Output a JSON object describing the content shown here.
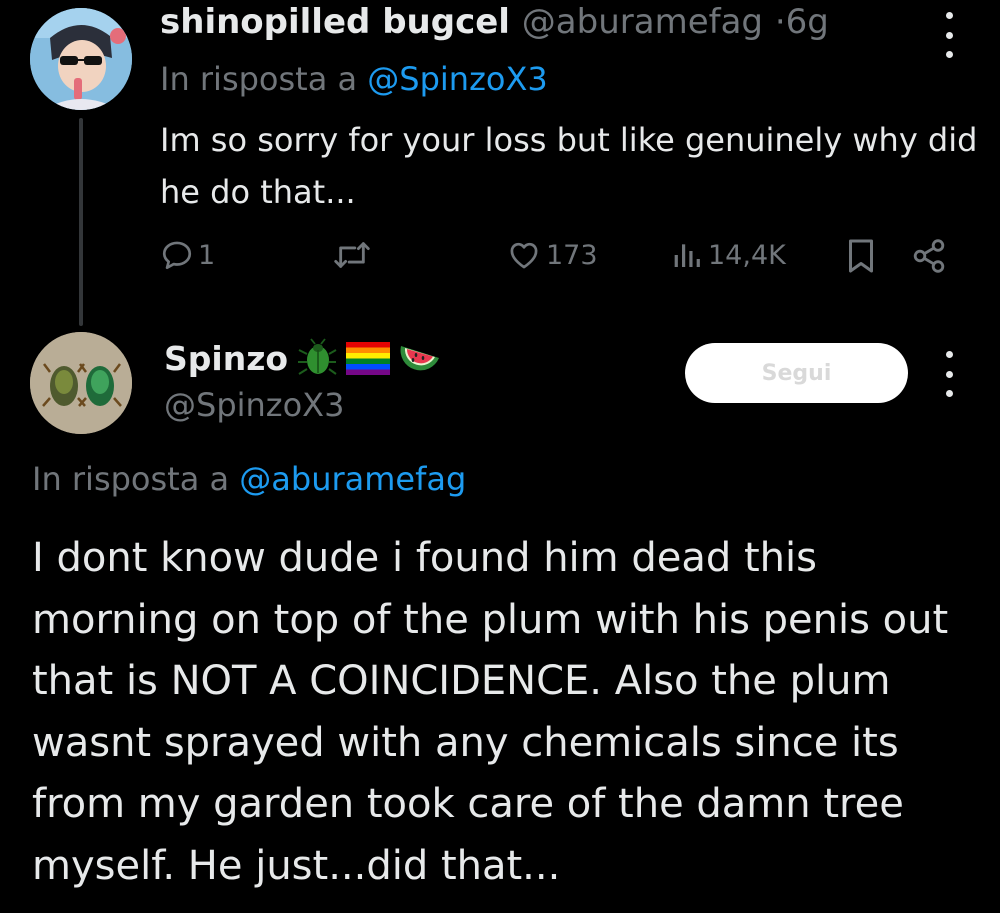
{
  "tweet1": {
    "author_name": "shinopilled bugcel",
    "author_handle": "@aburamefag",
    "separator": "·",
    "time": "6g",
    "reply_prefix": "In risposta a",
    "reply_to": "@SpinzoX3",
    "text": "Im so sorry for your loss but like genuinely why did he do that...",
    "actions": {
      "replies": "1",
      "likes": "173",
      "views": "14,4K"
    },
    "icons": [
      "reply-icon",
      "retweet-icon",
      "like-icon",
      "views-icon",
      "bookmark-icon",
      "share-icon",
      "more-icon"
    ]
  },
  "tweet2": {
    "author_name": "Spinzo",
    "name_emojis": [
      "🪲",
      "🏳️‍🌈",
      "🍉"
    ],
    "author_handle": "@SpinzoX3",
    "follow_label": "Segui",
    "reply_prefix": "In risposta a",
    "reply_to": "@aburamefag",
    "text": "I dont know dude i found him dead this morning on top of the plum with his penis out that is NOT A COINCIDENCE. Also the plum wasnt sprayed with any chemicals since its from my garden took care of the damn tree myself. He just...did that..."
  },
  "colors": {
    "background": "#000000",
    "text_primary": "#e7e9ea",
    "text_secondary": "#71767b",
    "link": "#1d9bf0"
  }
}
